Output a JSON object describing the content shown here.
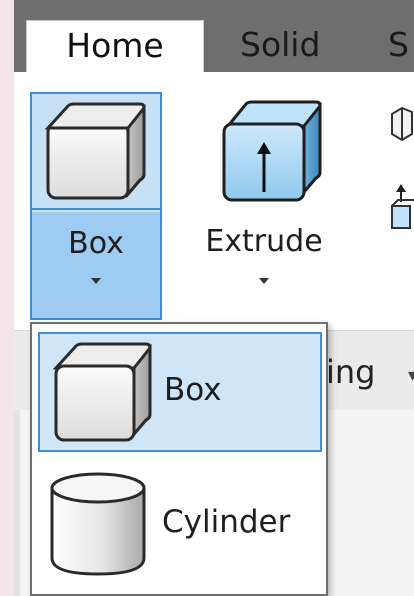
{
  "tabs": [
    {
      "label": "Home",
      "active": true
    },
    {
      "label": "Solid",
      "active": false
    },
    {
      "label": "S",
      "active": false
    }
  ],
  "ribbon": {
    "box_button": {
      "label": "Box",
      "icon": "box-icon"
    },
    "extrude_button": {
      "label": "Extrude",
      "icon": "extrude-icon"
    },
    "panel_footer_label": "ing"
  },
  "dropdown": {
    "items": [
      {
        "label": "Box",
        "icon": "box-icon",
        "selected": true
      },
      {
        "label": "Cylinder",
        "icon": "cylinder-icon",
        "selected": false
      }
    ]
  },
  "colors": {
    "highlight": "#cfe5f8",
    "highlight_border": "#3c8fd4",
    "tabbar": "#6e6e6e"
  }
}
